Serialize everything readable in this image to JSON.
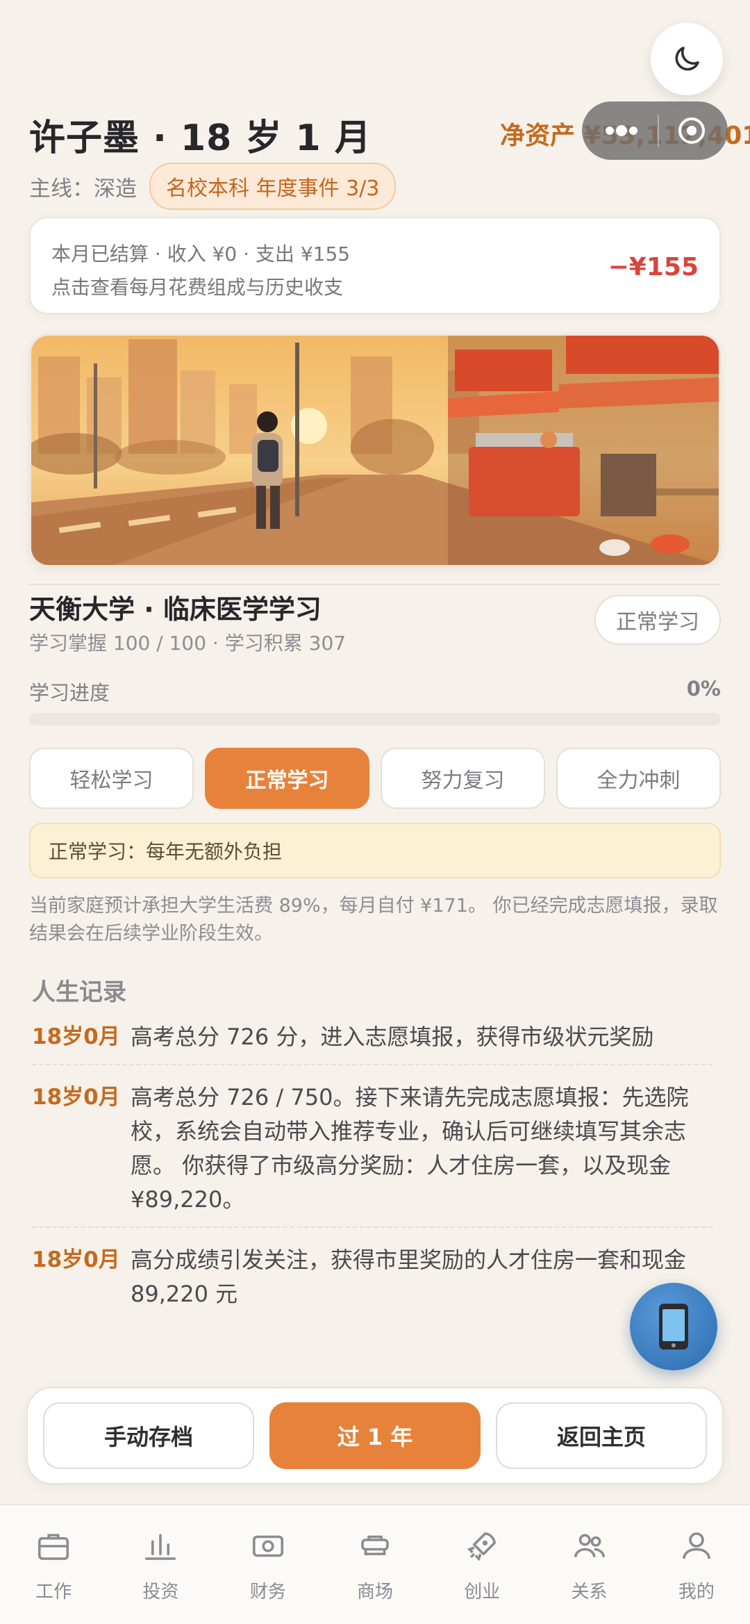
{
  "header": {
    "title": "许子墨 · 18 岁 1 月",
    "net_worth": "净资产 ¥53,112,401",
    "mainline_label": "主线：深造",
    "event_tag": "名校本科 年度事件 3/3"
  },
  "settlement": {
    "line1": "本月已结算 · 收入 ¥0 · 支出 ¥155",
    "line2": "点击查看每月花费组成与历史收支",
    "amount": "−¥155"
  },
  "study": {
    "university": "天衡大学 · 临床医学学习",
    "sub": "学习掌握 100 / 100 · 学习积累 307",
    "mode_badge": "正常学习",
    "progress_label": "学习进度",
    "progress_value": "0%",
    "progress_fraction": 0,
    "modes": [
      "轻松学习",
      "正常学习",
      "努力复习",
      "全力冲刺"
    ],
    "active_mode_index": 1,
    "note": "正常学习：每年无额外负担",
    "description": "当前家庭预计承担大学生活费 89%，每月自付 ¥171。 你已经完成志愿填报，录取结果会在后续学业阶段生效。"
  },
  "records": {
    "title": "人生记录",
    "items": [
      {
        "age": "18岁0月",
        "text": "高考总分 726 分，进入志愿填报，获得市级状元奖励"
      },
      {
        "age": "18岁0月",
        "text": "高考总分 726 / 750。接下来请先完成志愿填报：先选院校，系统会自动带入推荐专业，确认后可继续填写其余志愿。 你获得了市级高分奖励：人才住房一套，以及现金 ¥89,220。"
      },
      {
        "age": "18岁0月",
        "text": "高分成绩引发关注，获得市里奖励的人才住房一套和现金 89,220 元"
      }
    ]
  },
  "actions": {
    "save": "手动存档",
    "next_year": "过 1 年",
    "home": "返回主页"
  },
  "tabs": [
    {
      "label": "工作",
      "icon": "briefcase-icon"
    },
    {
      "label": "投资",
      "icon": "chart-icon"
    },
    {
      "label": "财务",
      "icon": "cash-icon"
    },
    {
      "label": "商场",
      "icon": "store-icon"
    },
    {
      "label": "创业",
      "icon": "rocket-icon"
    },
    {
      "label": "关系",
      "icon": "people-icon"
    },
    {
      "label": "我的",
      "icon": "user-icon"
    }
  ],
  "colors": {
    "accent": "#e7823a",
    "networth": "#c56a1e",
    "expense": "#d9443c",
    "background": "#f6f1ea"
  }
}
